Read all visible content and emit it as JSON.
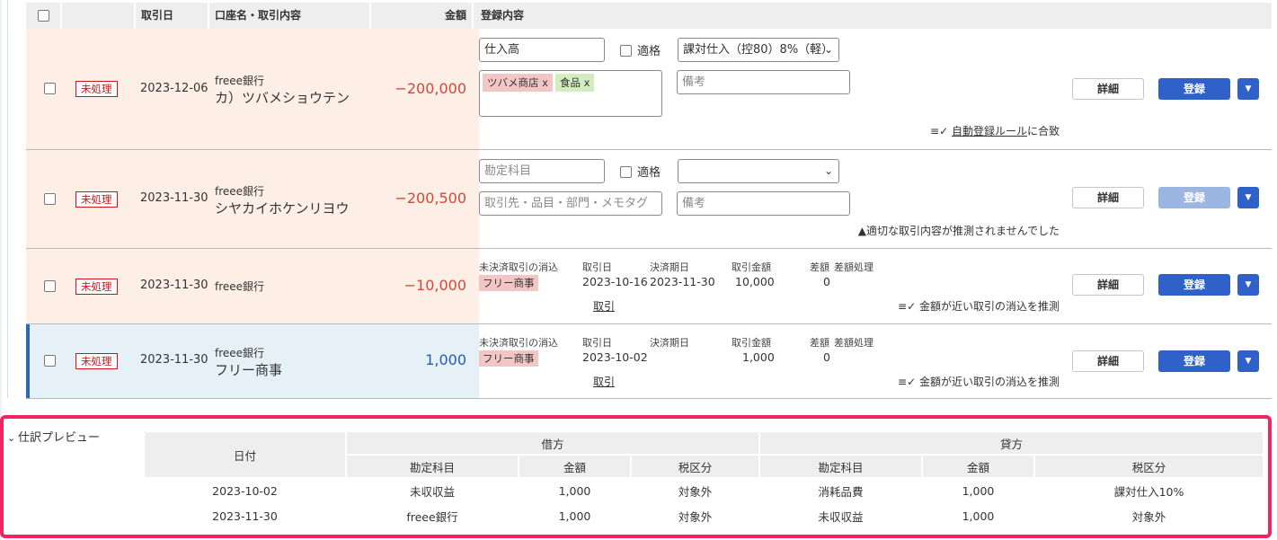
{
  "header": {
    "date": "取引日",
    "account": "口座名・取引内容",
    "amount": "金額",
    "registration": "登録内容"
  },
  "buttons": {
    "detail": "詳細",
    "register": "登録"
  },
  "rows": [
    {
      "status": "未処理",
      "date": "2023-12-06",
      "bank": "freee銀行",
      "description": "カ）ツバメショウテン",
      "amount": "−200,000",
      "account_value": "仕入高",
      "tekikaku": "適格",
      "tax": "課対仕入（控80）8%（軽）",
      "tags": [
        "ツバメ商店 x",
        "食品 x"
      ],
      "memo_placeholder": "備考",
      "note_link": "自動登録ルール",
      "note_rest": "に合致"
    },
    {
      "status": "未処理",
      "date": "2023-11-30",
      "bank": "freee銀行",
      "description": "シヤカイホケンリヨウ",
      "amount": "−200,500",
      "account_placeholder": "勘定科目",
      "tekikaku": "適格",
      "partner_placeholder": "取引先・品目・部門・メモタグ",
      "memo_placeholder": "備考",
      "note": "適切な取引内容が推測されませんでした"
    },
    {
      "status": "未処理",
      "date": "2023-11-30",
      "bank": "freee銀行",
      "amount": "−10,000",
      "labels": [
        "未決済取引の消込",
        "取引日",
        "決済期日",
        "取引金額",
        "差額",
        "差額処理"
      ],
      "chip": "フリー商事",
      "trade_date": "2023-10-16",
      "due_date": "2023-11-30",
      "trade_amount": "10,000",
      "diff": "0",
      "link": "取引",
      "note": "金額が近い取引の消込を推測"
    },
    {
      "status": "未処理",
      "date": "2023-11-30",
      "bank": "freee銀行",
      "description": "フリー商事",
      "amount": "1,000",
      "labels": [
        "未決済取引の消込",
        "取引日",
        "決済期日",
        "取引金額",
        "差額",
        "差額処理"
      ],
      "chip": "フリー商事",
      "trade_date": "2023-10-02",
      "trade_amount": "1,000",
      "diff": "0",
      "link": "取引",
      "note": "金額が近い取引の消込を推測"
    }
  ],
  "preview": {
    "title": "仕訳プレビュー",
    "date_header": "日付",
    "debit": "借方",
    "credit": "貸方",
    "sub": {
      "account": "勘定科目",
      "amount": "金額",
      "tax": "税区分"
    },
    "lines": [
      {
        "date": "2023-10-02",
        "d_account": "未収収益",
        "d_amount": "1,000",
        "d_tax": "対象外",
        "c_account": "消耗品費",
        "c_amount": "1,000",
        "c_tax": "課対仕入10%"
      },
      {
        "date": "2023-11-30",
        "d_account": "freee銀行",
        "d_amount": "1,000",
        "d_tax": "対象外",
        "c_account": "未収収益",
        "c_amount": "1,000",
        "c_tax": "対象外"
      }
    ]
  },
  "colors": {
    "accent": "#2f61c8",
    "unprocessed": "#c7171c",
    "negative": "#d4473c",
    "positive": "#2a58b5",
    "highlight": "#f2245f"
  }
}
